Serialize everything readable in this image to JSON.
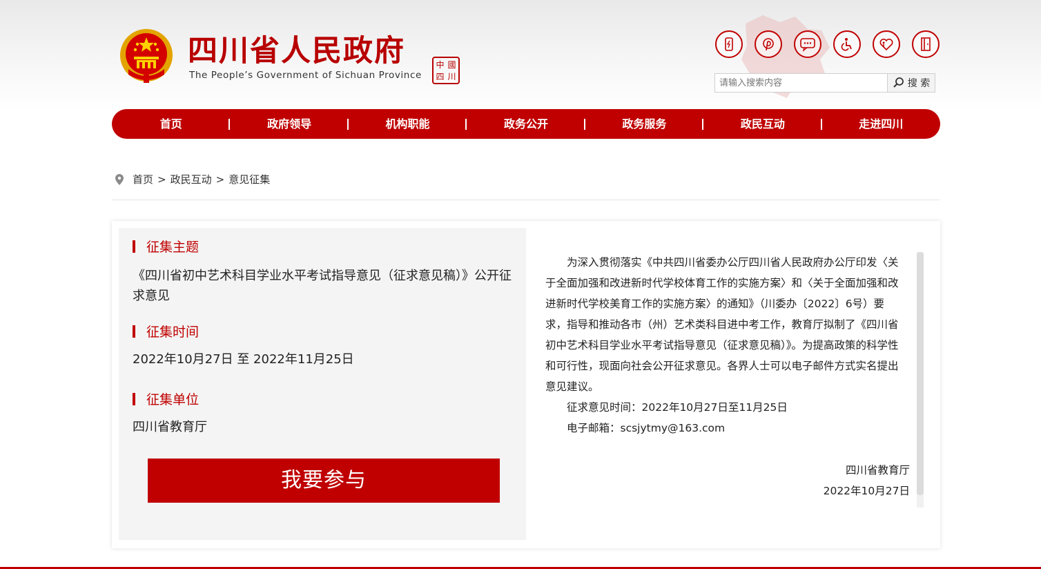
{
  "header": {
    "site_title": "四川省人民政府",
    "site_subtitle": "The People’s Government of Sichuan Province",
    "seal_chars": [
      "中",
      "國",
      "四",
      "川"
    ],
    "tool_icons": [
      "mobile-icon",
      "weibo-icon",
      "message-icon",
      "accessibility-icon",
      "elderly-care-icon",
      "exit-icon"
    ],
    "search": {
      "placeholder": "请输入搜索内容",
      "button_label": "搜 索"
    }
  },
  "nav": {
    "items": [
      "首页",
      "政府领导",
      "机构职能",
      "政务公开",
      "政务服务",
      "政民互动",
      "走进四川"
    ]
  },
  "breadcrumb": {
    "items": [
      "首页",
      "政民互动",
      "意见征集"
    ],
    "separator": ">"
  },
  "collection": {
    "topic_label": "征集主题",
    "topic": "《四川省初中艺术科目学业水平考试指导意见（征求意见稿）》公开征求意见",
    "time_label": "征集时间",
    "time": "2022年10月27日 至 2022年11月25日",
    "unit_label": "征集单位",
    "unit": "四川省教育厅",
    "join_button": "我要参与"
  },
  "notice": {
    "paragraph1": "为深入贯彻落实《中共四川省委办公厅四川省人民政府办公厅印发〈关于全面加强和改进新时代学校体育工作的实施方案〉和〈关于全面加强和改进新时代学校美育工作的实施方案〉的通知》（川委办〔2022〕6号）要求，指导和推动各市（州）艺术类科目进中考工作，教育厅拟制了《四川省初中艺术科目学业水平考试指导意见（征求意见稿）》。为提高政策的科学性和可行性，现面向社会公开征求意见。各界人士可以电子邮件方式实名提出意见建议。",
    "time_line": "征求意见时间：2022年10月27日至11月25日",
    "email_line": "电子邮箱：scsjytmy@163.com",
    "signature_org": "四川省教育厅",
    "signature_date": "2022年10月27日"
  },
  "colors": {
    "brand_red": "#c00000",
    "panel_gray": "#f4f4f4"
  }
}
